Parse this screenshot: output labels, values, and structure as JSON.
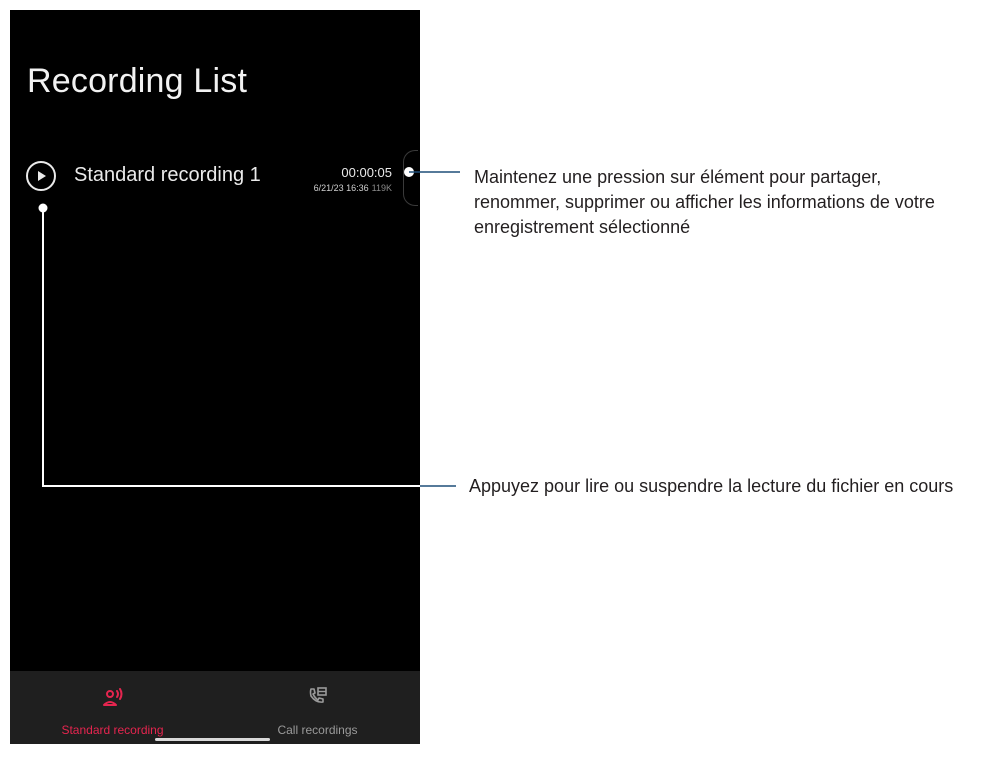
{
  "screen": {
    "title": "Recording List"
  },
  "recordings": [
    {
      "name": "Standard recording 1",
      "duration": "00:00:05",
      "datetime": "6/21/23 16:36",
      "size": "119K"
    }
  ],
  "bottom_nav": {
    "tabs": [
      {
        "label": "Standard recording",
        "icon": "person-voice-icon",
        "active": true,
        "color": "#e5254f"
      },
      {
        "label": "Call recordings",
        "icon": "phone-list-icon",
        "active": false,
        "color": "#9a9a9a"
      }
    ]
  },
  "callouts": {
    "item_hint_line1": "Maintenez une pression sur élément pour partager,",
    "item_hint_line2": "renommer, supprimer ou afficher les informations de votre",
    "item_hint_line3": "enregistrement sélectionné",
    "play_hint": "Appuyez pour lire ou suspendre la lecture du fichier en cours",
    "line_color": "#1f4e79"
  }
}
